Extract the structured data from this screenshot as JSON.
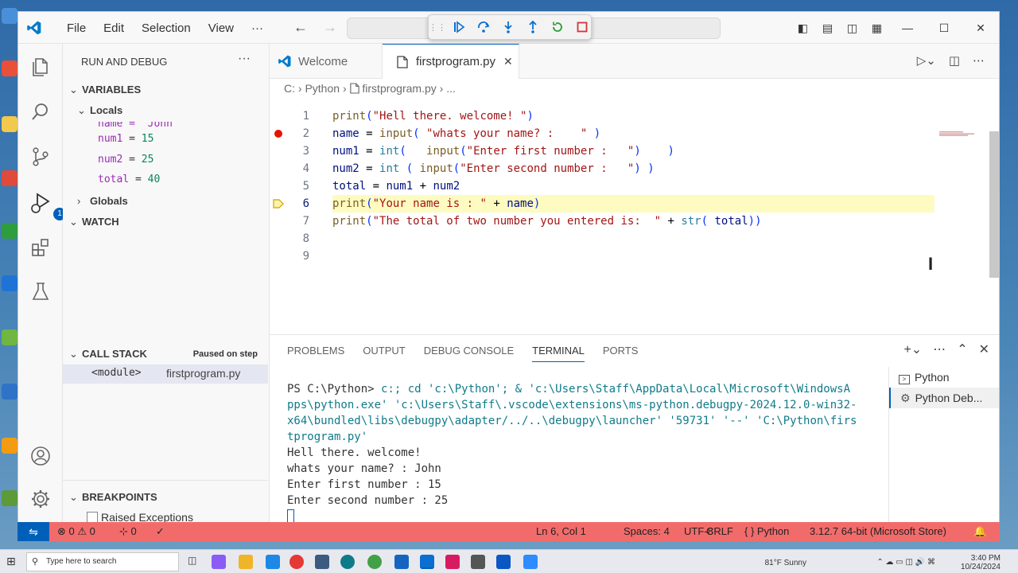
{
  "window": {
    "menu": [
      "File",
      "Edit",
      "Selection",
      "View",
      "···"
    ]
  },
  "colors": {
    "accent": "#005fb8",
    "status_bar": "#f26b6b",
    "current_line": "#fefbc0",
    "breakpoint": "#e51400"
  },
  "sidebar": {
    "title": "RUN AND DEBUG",
    "more": "···",
    "variables_header": "VARIABLES",
    "locals_label": "Locals",
    "partial_var": "name = 'John",
    "locals": [
      {
        "name": "num1",
        "value": "15"
      },
      {
        "name": "num2",
        "value": "25"
      },
      {
        "name": "total",
        "value": "40"
      }
    ],
    "globals_label": "Globals",
    "watch_header": "WATCH",
    "callstack_header": "CALL STACK",
    "paused_label": "Paused on step",
    "stack_frame": "<module>",
    "stack_file": "firstprogram.py",
    "breakpoints_header": "BREAKPOINTS",
    "raised_exceptions": "Raised Exceptions",
    "debug_badge": "1"
  },
  "editor": {
    "tabs": [
      {
        "label": "Welcome",
        "active": false
      },
      {
        "label": "firstprogram.py",
        "active": true
      }
    ],
    "close_glyph": "✕",
    "breadcrumb": [
      "C:",
      "Python",
      "firstprogram.py",
      "..."
    ],
    "current_line": 6,
    "breakpoint_line": 2,
    "lines": [
      {
        "n": "1",
        "text": "print(\"Hell there. welcome! \")"
      },
      {
        "n": "2",
        "text": "name = input( \"whats your name? :    \" )"
      },
      {
        "n": "3",
        "text": "num1 = int(   input(\"Enter first number :   \")    )"
      },
      {
        "n": "4",
        "text": "num2 = int ( input(\"Enter second number :   \") )"
      },
      {
        "n": "5",
        "text": "total = num1 + num2"
      },
      {
        "n": "6",
        "text": "print(\"Your name is : \" + name)"
      },
      {
        "n": "7",
        "text": "print(\"The total of two number you entered is:  \" + str( total))"
      },
      {
        "n": "8",
        "text": ""
      },
      {
        "n": "9",
        "text": ""
      }
    ]
  },
  "panel": {
    "tabs": [
      "PROBLEMS",
      "OUTPUT",
      "DEBUG CONSOLE",
      "TERMINAL",
      "PORTS"
    ],
    "active_tab": "TERMINAL",
    "terminal_lines": [
      "PS C:\\Python>  c:; cd 'c:\\Python'; & 'c:\\Users\\Staff\\AppData\\Local\\Microsoft\\WindowsA",
      "pps\\python.exe' 'c:\\Users\\Staff\\.vscode\\extensions\\ms-python.debugpy-2024.12.0-win32-",
      "x64\\bundled\\libs\\debugpy\\adapter/../..\\debugpy\\launcher' '59731' '--' 'C:\\Python\\firs",
      "tprogram.py'",
      "Hell there. welcome!",
      "whats your name? :    John",
      "Enter first number :   15",
      "Enter second number :   25"
    ],
    "terminals": [
      "Python",
      "Python Deb..."
    ]
  },
  "status": {
    "errors": "0",
    "warnings": "0",
    "ports": "0",
    "position": "Ln 6, Col 1",
    "spaces": "Spaces: 4",
    "encoding": "UTF-8",
    "eol": "CRLF",
    "language_icon": "{ }",
    "language": "Python",
    "interpreter": "3.12.7 64-bit (Microsoft Store)"
  },
  "taskbar": {
    "search_placeholder": "Type here to search",
    "weather": "81°F  Sunny",
    "time": "3:40 PM",
    "date": "10/24/2024"
  }
}
